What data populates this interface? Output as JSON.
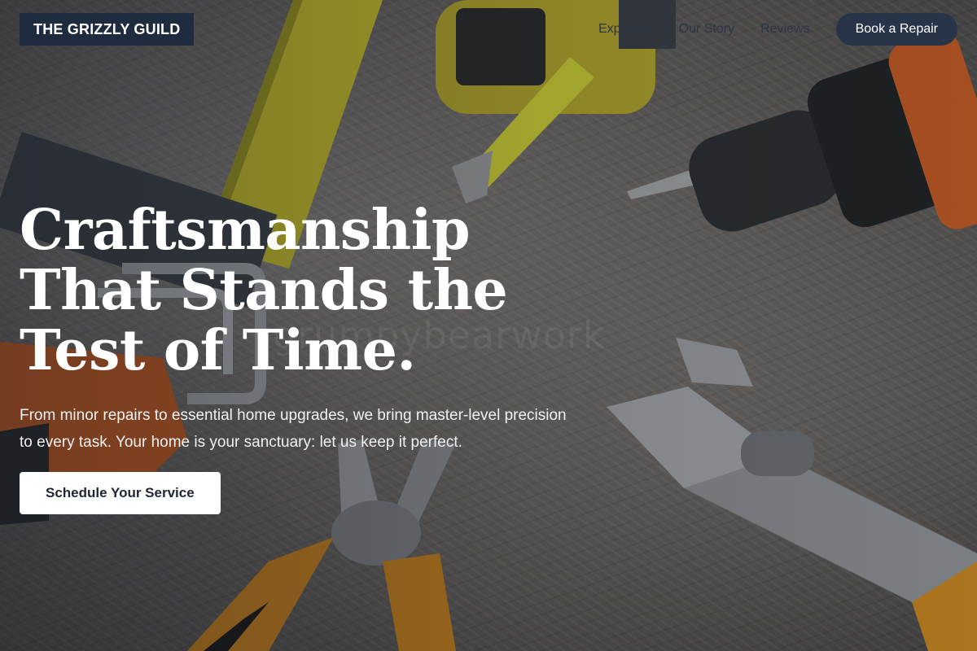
{
  "brand": {
    "name": "THE GRIZZLY GUILD"
  },
  "nav": {
    "items": [
      {
        "label": "Expertise"
      },
      {
        "label": "Our Story"
      },
      {
        "label": "Reviews"
      }
    ],
    "cta_label": "Book a Repair"
  },
  "hero": {
    "headline": "Craftsmanship That Stands the Test of Time.",
    "subtext": "From minor repairs to essential home upgrades, we bring master-level precision to every task. Your home is your sanctuary: let us keep it perfect.",
    "cta_label": "Schedule Your Service",
    "watermark": "grumpybearwork"
  },
  "colors": {
    "brand_bg": "#1f2b3f",
    "nav_cta_bg": "#27344a",
    "cta_bg": "#ffffff",
    "headline": "#ffffff"
  },
  "icons": [
    "tape-measure-icon",
    "drill-icon",
    "wrench-icon",
    "pliers-icon",
    "ruler-icon",
    "hex-keys-icon"
  ]
}
